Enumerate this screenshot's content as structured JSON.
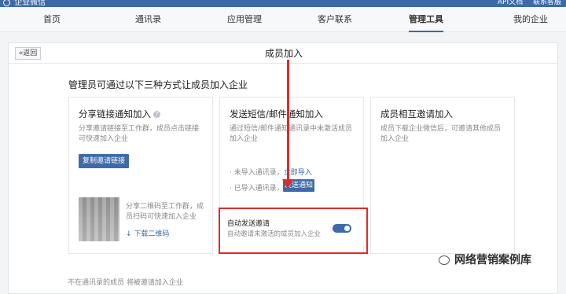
{
  "topbar": {
    "brand": "企业微信",
    "links": [
      "API文档",
      "联系客服"
    ]
  },
  "nav": {
    "items": [
      "首页",
      "通讯录",
      "应用管理",
      "客户联系",
      "管理工具",
      "我的企业"
    ],
    "active_index": 4
  },
  "header": {
    "back_label": "«返回",
    "title": "成员加入"
  },
  "section_title": "管理员可通过以下三种方式让成员加入企业",
  "card1": {
    "title": "分享链接通知加入",
    "help": "?",
    "desc": "分享邀请链接至工作群，成员点击链接可快速加入企业",
    "button": "复制邀请链接",
    "qr_desc": "分享二维码至工作群，成员扫码可快速加入企业",
    "download": "↓ 下载二维码"
  },
  "card2": {
    "title": "发送短信/邮件通知加入",
    "desc": "通过短信/邮件通知通讯录中未激活成员加入企业",
    "bullet1_text": "· 未导入通讯录，",
    "bullet1_link": "立即导入",
    "bullet2_text": "· 已导入通讯录，",
    "notice_button": "发送通知",
    "auto_title": "自动发送邀请",
    "auto_desc": "自动邀请未激活的成员加入企业",
    "auto_enabled": true
  },
  "card3": {
    "title": "成员相互邀请加入",
    "desc": "成员下载企业微信后，可邀请其他成员加入企业"
  },
  "footer_note": "不在通讯录的成员 将被邀请加入企业",
  "watermark": "网络营销案例库"
}
